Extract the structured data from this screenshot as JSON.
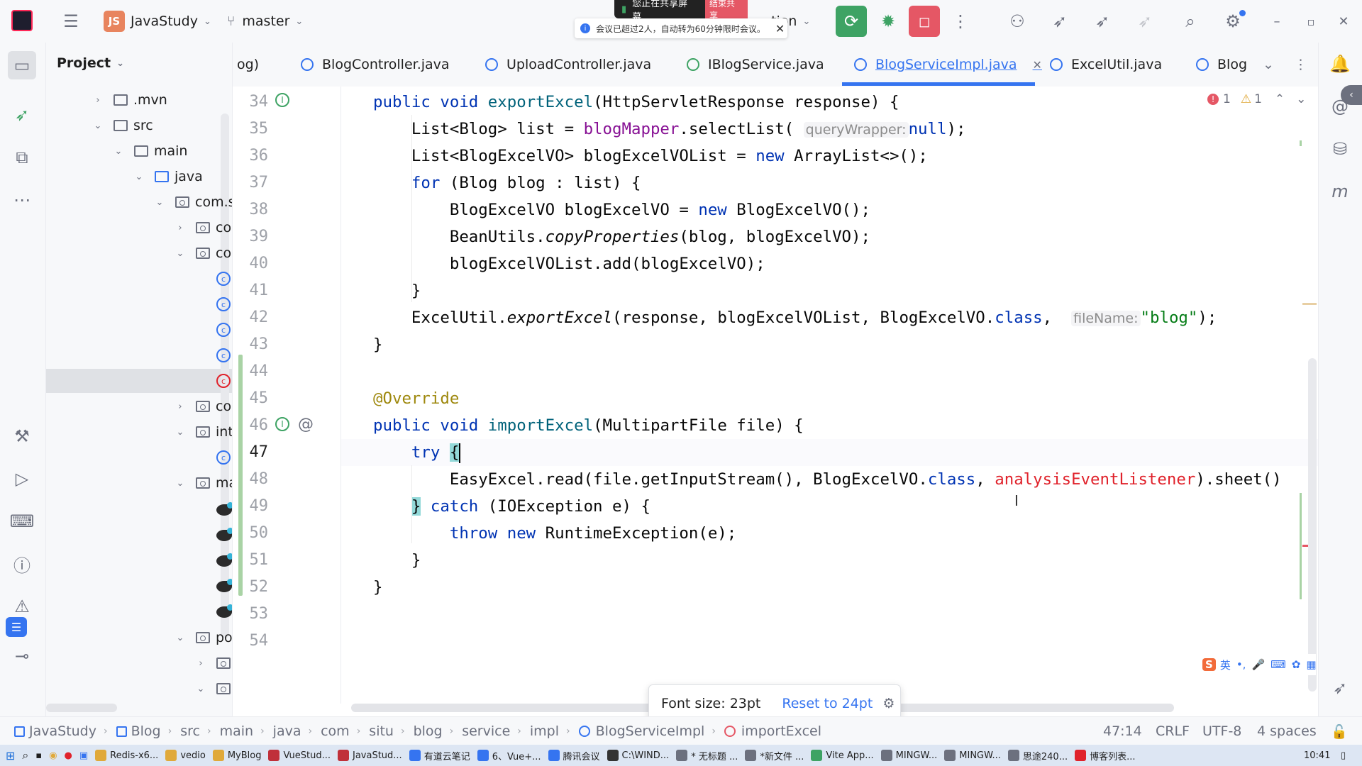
{
  "titlebar": {
    "project_initials": "JS",
    "project_name": "JavaStudy",
    "branch": "master",
    "run_config": "..tion",
    "sharing_label": "您正在共享屏幕",
    "stop_sharing": "结束共享",
    "meeting_notice": "会议已超过2人，自动转为60分钟限时会议。"
  },
  "project_panel": {
    "title": "Project",
    "rows": [
      {
        "label": ".mvn"
      },
      {
        "label": "src"
      },
      {
        "label": "main"
      },
      {
        "label": "java"
      },
      {
        "label": "com.si"
      },
      {
        "label": "co"
      },
      {
        "label": "co"
      },
      {
        "label": "co"
      },
      {
        "label": "int"
      },
      {
        "label": "ma"
      },
      {
        "label": "po"
      }
    ]
  },
  "tabs": [
    {
      "label": "og)"
    },
    {
      "label": "BlogController.java"
    },
    {
      "label": "UploadController.java"
    },
    {
      "label": "IBlogService.java"
    },
    {
      "label": "BlogServiceImpl.java"
    },
    {
      "label": "ExcelUtil.java"
    },
    {
      "label": "Blog"
    }
  ],
  "inspections": {
    "errors": "1",
    "warnings": "1"
  },
  "editor": {
    "line_numbers": [
      "34",
      "35",
      "36",
      "37",
      "38",
      "39",
      "40",
      "41",
      "42",
      "43",
      "44",
      "45",
      "46",
      "47",
      "48",
      "49",
      "50",
      "51",
      "52",
      "53",
      "54"
    ],
    "hints": {
      "query_wrapper": "queryWrapper:",
      "file_name": "fileName:"
    }
  },
  "font_popup": {
    "label": "Font size: 23pt",
    "reset": "Reset to 24pt"
  },
  "statusbar": {
    "breadcrumbs": [
      "JavaStudy",
      "Blog",
      "src",
      "main",
      "java",
      "com",
      "situ",
      "blog",
      "service",
      "impl",
      "BlogServiceImpl",
      "importExcel"
    ],
    "position": "47:14",
    "line_sep": "CRLF",
    "encoding": "UTF-8",
    "indent": "4 spaces"
  },
  "taskbar": {
    "items": [
      "Redis-x6...",
      "vedio",
      "MyBlog",
      "VueStud...",
      "JavaStud...",
      "有道云笔记",
      "6、Vue+...",
      "腾讯会议",
      "C:\\WIND...",
      "* 无标题 ...",
      "*新文件 ...",
      "Vite App...",
      "MINGW...",
      "MINGW...",
      "思途240...",
      "博客列表..."
    ],
    "clock": "10:41"
  },
  "ime": {
    "label": "英"
  },
  "colors": {
    "accent": "#3574f0",
    "keyword": "#0033b3",
    "string": "#067d17",
    "error": "#e0222b"
  }
}
